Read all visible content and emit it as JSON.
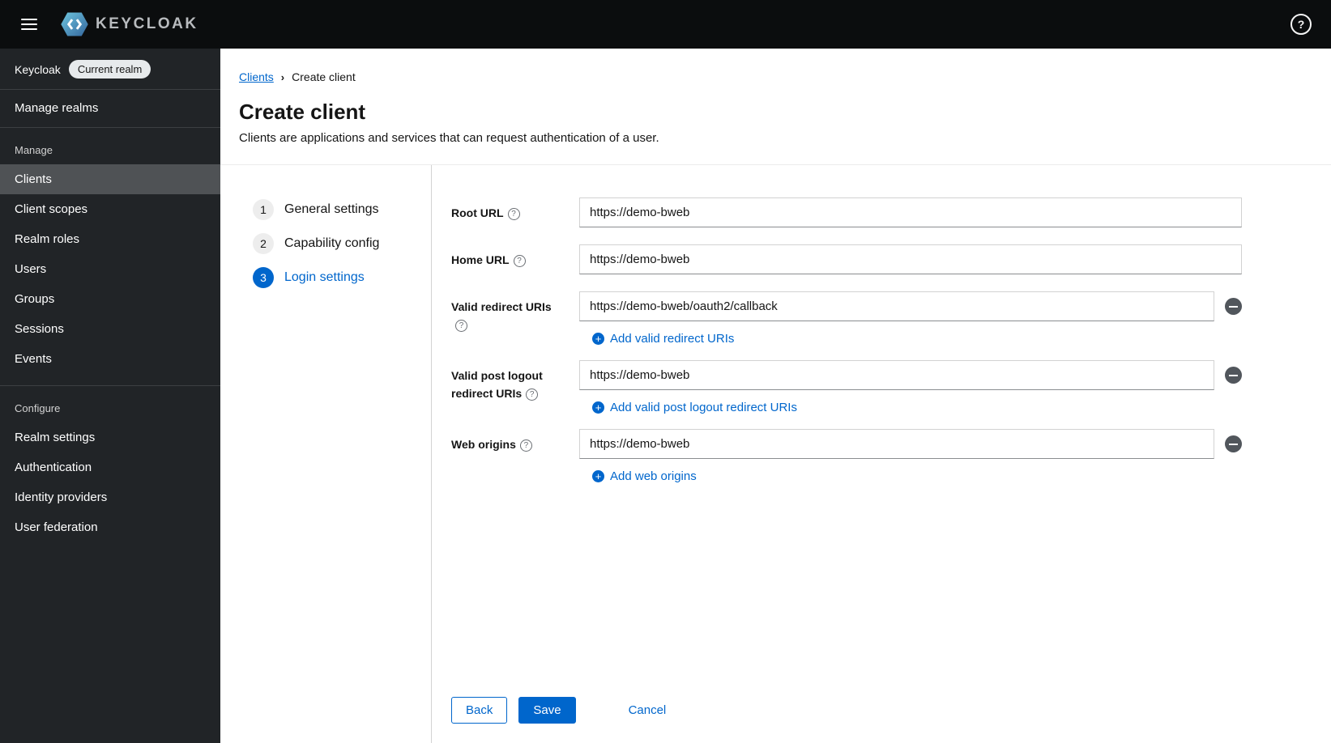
{
  "topbar": {
    "brand": "KEYCLOAK"
  },
  "sidebar": {
    "realm_name": "Keycloak",
    "realm_badge": "Current realm",
    "manage_realms": "Manage realms",
    "section_manage": "Manage",
    "section_configure": "Configure",
    "manage_items": [
      "Clients",
      "Client scopes",
      "Realm roles",
      "Users",
      "Groups",
      "Sessions",
      "Events"
    ],
    "configure_items": [
      "Realm settings",
      "Authentication",
      "Identity providers",
      "User federation"
    ]
  },
  "breadcrumb": {
    "link": "Clients",
    "current": "Create client"
  },
  "page": {
    "title": "Create client",
    "subtitle": "Clients are applications and services that can request authentication of a user."
  },
  "wizard": {
    "steps": [
      {
        "number": "1",
        "label": "General settings"
      },
      {
        "number": "2",
        "label": "Capability config"
      },
      {
        "number": "3",
        "label": "Login settings"
      }
    ]
  },
  "form": {
    "fields": [
      {
        "label": "Root URL",
        "value": "https://demo-bweb"
      },
      {
        "label": "Home URL",
        "value": "https://demo-bweb"
      },
      {
        "label": "Valid redirect URIs",
        "value": "https://demo-bweb/oauth2/callback",
        "add_label": "Add valid redirect URIs"
      },
      {
        "label": "Valid post logout redirect URIs",
        "value": "https://demo-bweb",
        "add_label": "Add valid post logout redirect URIs"
      },
      {
        "label": "Web origins",
        "value": "https://demo-bweb",
        "add_label": "Add web origins"
      }
    ],
    "actions": {
      "back": "Back",
      "save": "Save",
      "cancel": "Cancel"
    }
  },
  "colors": {
    "primary": "#0066cc",
    "topbar_bg": "#0b0d0e",
    "sidebar_bg": "#212427",
    "sidebar_selected": "#4f5255"
  }
}
